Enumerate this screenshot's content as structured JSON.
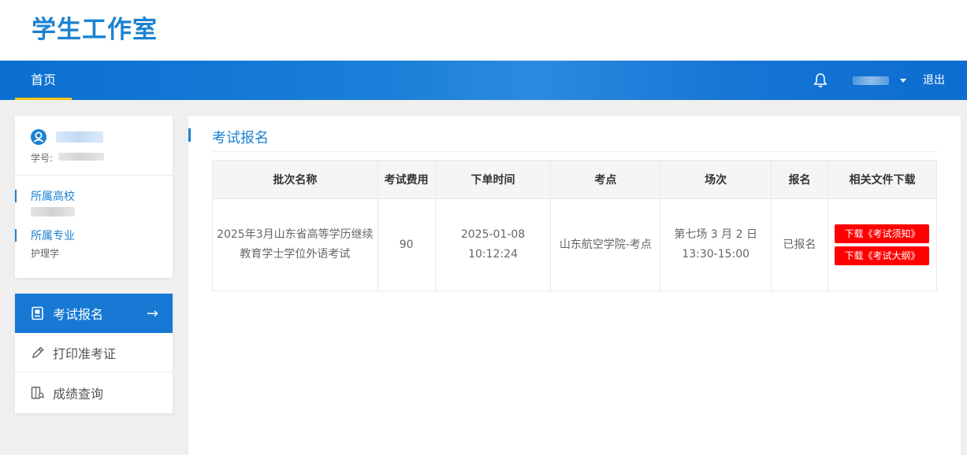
{
  "header": {
    "logo": "学生工作室"
  },
  "nav": {
    "home": "首页",
    "logout": "退出"
  },
  "profile": {
    "student_id_label": "学号:",
    "school_label": "所属高校",
    "major_label": "所属专业",
    "major_value": "护理学"
  },
  "menu": [
    {
      "label": "考试报名",
      "icon": "register-icon",
      "active": true
    },
    {
      "label": "打印准考证",
      "icon": "pencil-icon",
      "active": false
    },
    {
      "label": "成绩查询",
      "icon": "score-search-icon",
      "active": false
    }
  ],
  "section": {
    "title": "考试报名"
  },
  "table": {
    "headers": [
      "批次名称",
      "考试费用",
      "下单时间",
      "考点",
      "场次",
      "报名",
      "相关文件下载"
    ],
    "rows": [
      {
        "batch_line1": "2025年3月山东省高等学历继续",
        "batch_line2": "教育学士学位外语考试",
        "fee": "90",
        "order_time": "2025-01-08 10:12:24",
        "site": "山东航空学院-考点",
        "session_line1": "第七场 3 月 2 日",
        "session_line2": "13:30-15:00",
        "status": "已报名",
        "download1": "下载《考试须知》",
        "download2": "下载《考试大纲》"
      }
    ]
  },
  "colors": {
    "primary": "#1b82d2",
    "nav_bg": "#0a6fd0",
    "accent": "#f0c419",
    "download_button": "#ff0000"
  }
}
